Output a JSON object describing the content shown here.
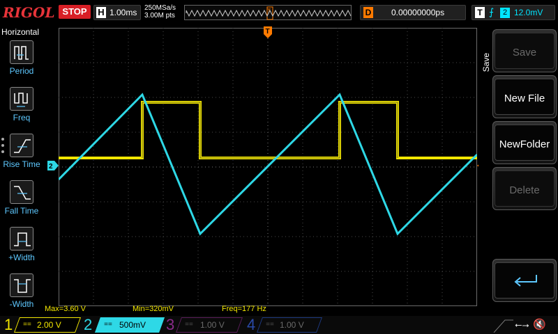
{
  "topbar": {
    "brand": "RIGOL",
    "run_state": "STOP",
    "timebase_label": "H",
    "timebase_value": "1.00ms",
    "sample_rate": "250MSa/s",
    "memory_depth": "3.00M pts",
    "memory_trigger_marker": "T",
    "delay_label": "D",
    "delay_value": "0.00000000ps",
    "trigger_label": "T",
    "trigger_edge_icon": "rising-edge-icon",
    "trigger_source": "2",
    "trigger_level": "12.0mV"
  },
  "left_menu": {
    "title": "Horizontal",
    "items": [
      {
        "label": "Period",
        "icon": "period-icon"
      },
      {
        "label": "Freq",
        "icon": "frequency-icon"
      },
      {
        "label": "Rise Time",
        "icon": "rise-time-icon"
      },
      {
        "label": "Fall Time",
        "icon": "fall-time-icon"
      },
      {
        "label": "+Width",
        "icon": "positive-width-icon"
      },
      {
        "label": "-Width",
        "icon": "negative-width-icon"
      }
    ]
  },
  "right_menu": {
    "title": "Save",
    "buttons": [
      {
        "label": "Save",
        "enabled": false
      },
      {
        "label": "New File",
        "enabled": true
      },
      {
        "label": "NewFolder",
        "enabled": true
      },
      {
        "label": "Delete",
        "enabled": false
      }
    ],
    "return_icon": "return-arrow-icon"
  },
  "waveform": {
    "trigger_marker": "T",
    "ch2_ground_marker": "2",
    "ch1_color": "#f2e600",
    "ch2_color": "#2ed8e6",
    "grid_color": "#6b6b6b"
  },
  "measurements": {
    "max": "Max=3.60 V",
    "min": "Min=320mV",
    "freq": "Freq=177 Hz"
  },
  "channels": [
    {
      "number": "1",
      "coupling": "==",
      "scale": "2.00 V",
      "color": "#f2e600",
      "active": true
    },
    {
      "number": "2",
      "coupling": "==",
      "scale": "500mV",
      "color": "#2ed8e6",
      "active": true
    },
    {
      "number": "3",
      "coupling": "==",
      "scale": "1.00 V",
      "color": "#b030b0",
      "active": false
    },
    {
      "number": "4",
      "coupling": "==",
      "scale": "1.00 V",
      "color": "#3060d8",
      "active": false
    }
  ],
  "status": {
    "usb_icon": "usb-icon",
    "mute_icon": "speaker-mute-icon"
  }
}
